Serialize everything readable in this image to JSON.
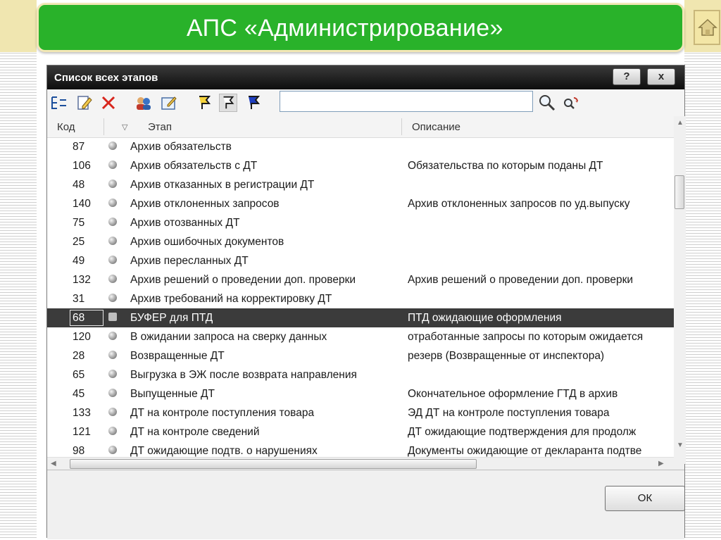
{
  "banner": {
    "title": "АПС «Администрирование»"
  },
  "window": {
    "title": "Список всех этапов",
    "help_label": "?",
    "close_label": "x"
  },
  "search": {
    "value": ""
  },
  "columns": {
    "code": "Код",
    "sort_marker": "▽",
    "stage": "Этап",
    "description": "Описание"
  },
  "rows": [
    {
      "code": "87",
      "stage": "Архив обязательств",
      "description": ""
    },
    {
      "code": "106",
      "stage": "Архив обязательств с ДТ",
      "description": "Обязательства по которым поданы ДТ"
    },
    {
      "code": "48",
      "stage": "Архив отказанных в регистрации ДТ",
      "description": ""
    },
    {
      "code": "140",
      "stage": "Архив отклоненных запросов",
      "description": "Архив отклоненных запросов по уд.выпуску"
    },
    {
      "code": "75",
      "stage": "Архив отозванных ДТ",
      "description": ""
    },
    {
      "code": "25",
      "stage": "Архив ошибочных документов",
      "description": ""
    },
    {
      "code": "49",
      "stage": "Архив пересланных ДТ",
      "description": ""
    },
    {
      "code": "132",
      "stage": "Архив решений о проведении доп. проверки",
      "description": "Архив решений о проведении доп. проверки"
    },
    {
      "code": "31",
      "stage": "Архив требований на корректировку ДТ",
      "description": ""
    },
    {
      "code": "68",
      "stage": "БУФЕР для ПТД",
      "description": "ПТД ожидающие оформления",
      "selected": true
    },
    {
      "code": "120",
      "stage": "В ожидании запроса на сверку данных",
      "description": "отработанные запросы по которым ожидается"
    },
    {
      "code": "28",
      "stage": "Возвращенные ДТ",
      "description": "резерв (Возвращенные от инспектора)"
    },
    {
      "code": "65",
      "stage": "Выгрузка в ЭЖ после возврата направления",
      "description": ""
    },
    {
      "code": "45",
      "stage": "Выпущенные ДТ",
      "description": "Окончательное оформление ГТД в архив"
    },
    {
      "code": "133",
      "stage": "ДТ на контроле поступления товара",
      "description": "ЭД ДТ на контроле поступления товара"
    },
    {
      "code": "121",
      "stage": "ДТ на контроле сведений",
      "description": "ДТ ожидающие подтверждения для продолж"
    },
    {
      "code": "98",
      "stage": "ДТ ожидающие подтв. о нарушениях",
      "description": "Документы ожидающие от декларанта подтве"
    }
  ],
  "footer": {
    "ok_label": "ОК"
  },
  "colors": {
    "banner": "#29b22a",
    "titlebar": "#1a1a1a",
    "selected_row": "#3b3b3b"
  }
}
